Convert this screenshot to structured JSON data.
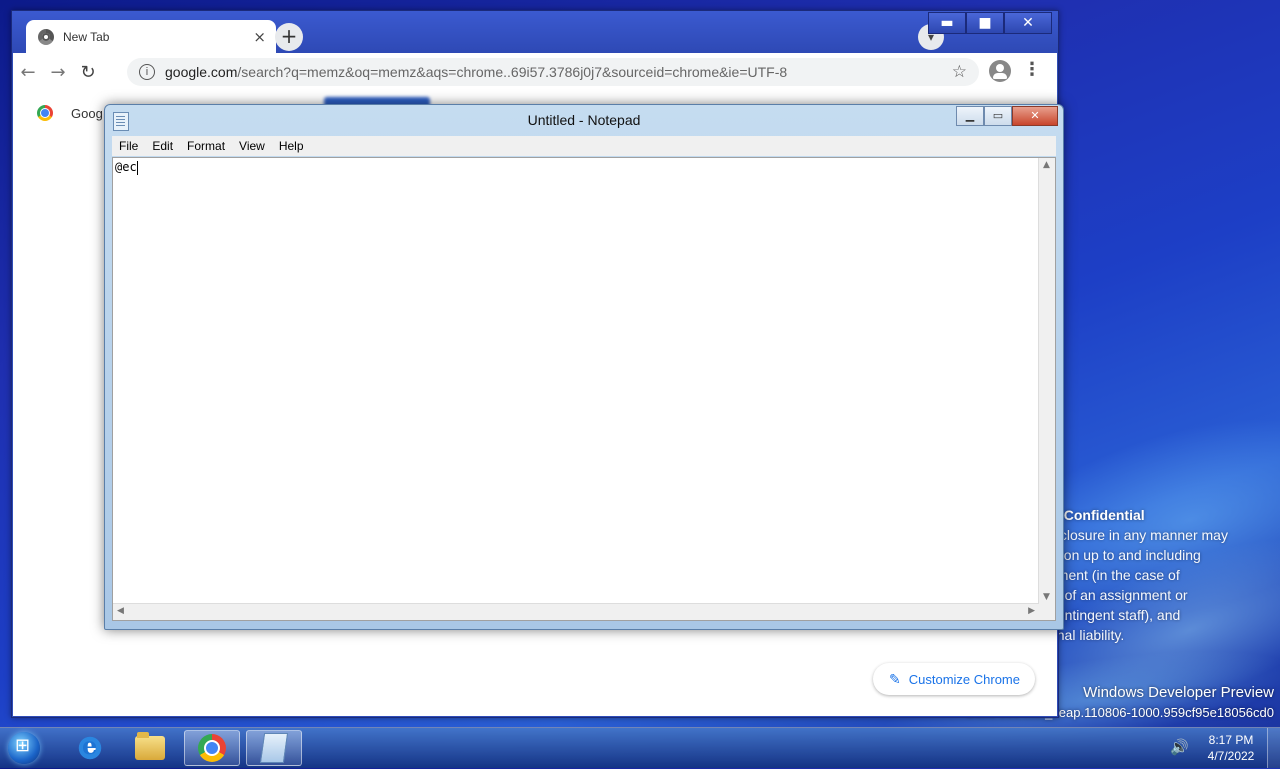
{
  "desktop": {
    "watermark": {
      "title": "oft Confidential",
      "lines": [
        "disclosure in any manner may",
        "action up to and including",
        "oyment (in the case of",
        "ion of an assignment or",
        "f contingent staff), and",
        "minal liability."
      ]
    },
    "preview_line1": "Windows Developer Preview",
    "preview_line2": "Build 8004.fbl_ceap.110806-1000.959cf95e18056cd0"
  },
  "chrome": {
    "tab_title": "New Tab",
    "tab_close": "×",
    "new_tab": "+",
    "url_host": "google.com",
    "url_path": "/search?q=memz&oq=memz&aqs=chrome..69i57.3786j0j7&sourceid=chrome&ie=UTF-8",
    "window_controls": {
      "minimize": "▬",
      "maximize": "■",
      "close": "✕"
    },
    "bookmark_label": "Goog",
    "customize_label": "Customize Chrome"
  },
  "notepad": {
    "title": "Untitled - Notepad",
    "menu": [
      "File",
      "Edit",
      "Format",
      "View",
      "Help"
    ],
    "content": "@ec",
    "controls": {
      "minimize": "▁",
      "maximize": "▭",
      "close": "✕"
    }
  },
  "taskbar": {
    "clock_time": "8:17 PM",
    "clock_date": "4/7/2022"
  },
  "colors": {
    "desktop_bg": "#1f2fb0",
    "chrome_frame": "#2f4db8",
    "notepad_frame": "#a9c7e6",
    "link_blue": "#1a73e8"
  }
}
